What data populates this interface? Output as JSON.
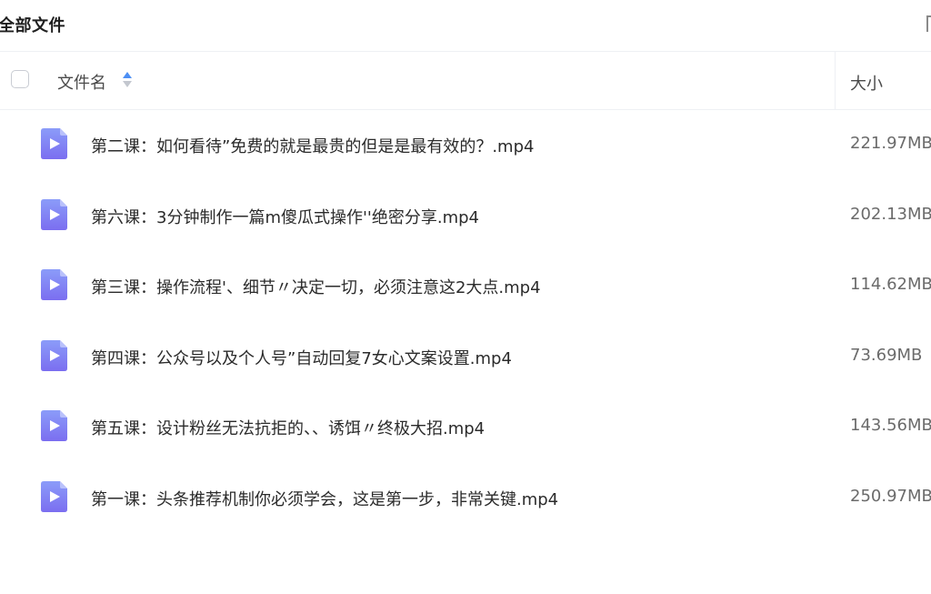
{
  "header": {
    "title": "全部文件"
  },
  "table": {
    "columns": {
      "name": "文件名",
      "size": "大小"
    },
    "sort": {
      "column": "name",
      "direction": "ascending"
    },
    "rows": [
      {
        "name": "第二课：如何看待”免费的就是最贵的但是是最有效的？.mp4",
        "size": "221.97MB",
        "icon": "video-file-icon"
      },
      {
        "name": "第六课：3分钟制作一篇m傻瓜式操作''绝密分享.mp4",
        "size": "202.13MB",
        "icon": "video-file-icon"
      },
      {
        "name": "第三课：操作流程'、细节〃决定一切，必须注意这2大点.mp4",
        "size": "114.62MB",
        "icon": "video-file-icon"
      },
      {
        "name": "第四课：公众号以及个人号”自动回复7女心文案设置.mp4",
        "size": "73.69MB",
        "icon": "video-file-icon"
      },
      {
        "name": "第五课：设计粉丝无法抗拒的、、诱饵〃终极大招.mp4",
        "size": "143.56MB",
        "icon": "video-file-icon"
      },
      {
        "name": "第一课：头条推荐机制你必须学会，这是第一步，非常关键.mp4",
        "size": "250.97MB",
        "icon": "video-file-icon"
      }
    ]
  },
  "colors": {
    "icon_gradient_top": "#8b9cf9",
    "icon_gradient_bottom": "#7b6ef0",
    "sort_active": "#4d8ff4",
    "divider": "#eef0f4"
  }
}
